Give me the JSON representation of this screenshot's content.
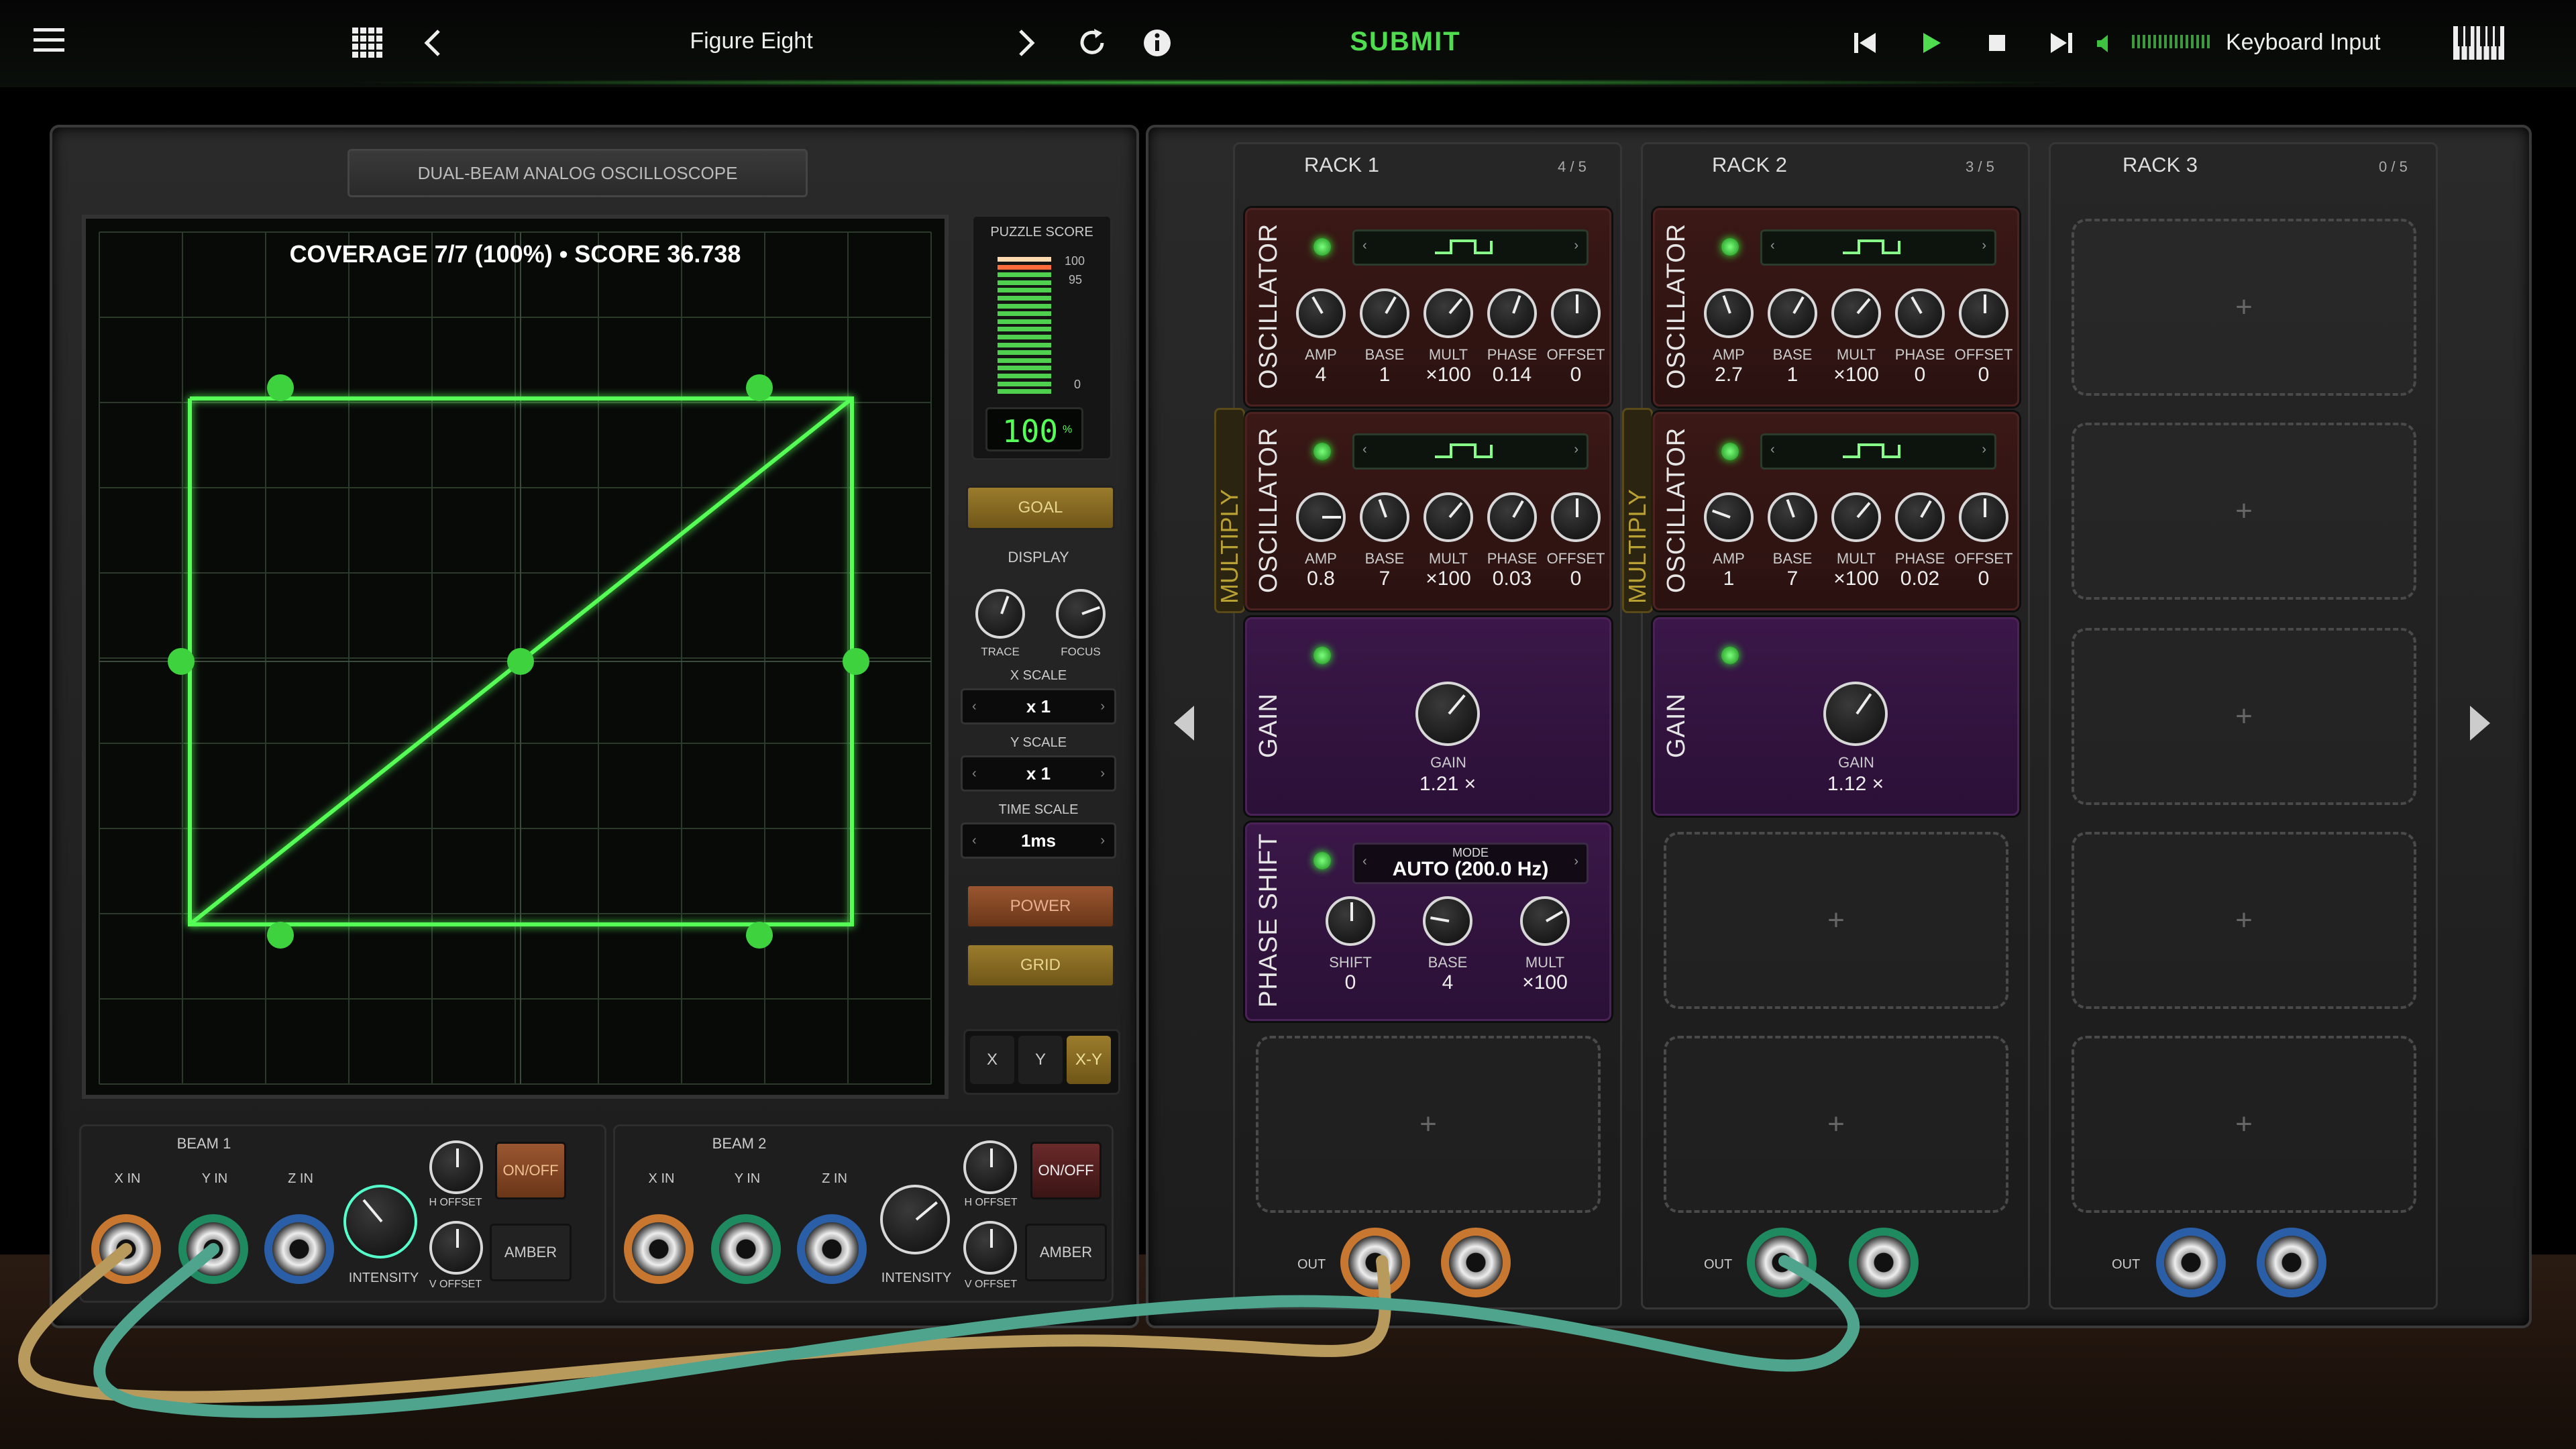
{
  "topbar": {
    "title": "Figure Eight",
    "submit": "SUBMIT",
    "keyboard_input": "Keyboard Input",
    "icons": [
      "menu-icon",
      "grid-icon",
      "chevron-left-icon",
      "chevron-right-icon",
      "restart-icon",
      "info-icon",
      "skip-back-icon",
      "play-icon",
      "stop-icon",
      "skip-forward-icon",
      "volume-icon",
      "piano-keys-icon"
    ]
  },
  "scope": {
    "nameplate": "DUAL-BEAM ANALOG OSCILLOSCOPE",
    "overlay": "COVERAGE 7/7 (100%)  •  SCORE 36.738",
    "trace_color": "#55ff55",
    "goal_points": 7,
    "puzzle_score_label": "PUZZLE SCORE",
    "meter_ticks": [
      "100",
      "95",
      "0"
    ],
    "score_readout": "100",
    "score_unit": "%",
    "meter_level": 1.0,
    "goal": "GOAL",
    "display": "DISPLAY",
    "trace": "TRACE",
    "focus": "FOCUS",
    "x_scale_label": "X SCALE",
    "x_scale": "x 1",
    "y_scale_label": "Y SCALE",
    "y_scale": "x 1",
    "time_scale_label": "TIME SCALE",
    "time_scale": "1ms",
    "power": "POWER",
    "grid": "GRID",
    "modes": [
      "X",
      "Y",
      "X-Y"
    ]
  },
  "beams": [
    {
      "title": "BEAM 1",
      "x_in": "X IN",
      "y_in": "Y IN",
      "z_in": "Z IN",
      "intensity": "INTENSITY",
      "h_offset": "H OFFSET",
      "v_offset": "V OFFSET",
      "onoff": "ON/OFF",
      "amber": "AMBER"
    },
    {
      "title": "BEAM 2",
      "x_in": "X IN",
      "y_in": "Y IN",
      "z_in": "Z IN",
      "intensity": "INTENSITY",
      "h_offset": "H OFFSET",
      "v_offset": "V OFFSET",
      "onoff": "ON/OFF",
      "amber": "AMBER"
    }
  ],
  "racks": [
    {
      "title": "RACK 1",
      "count": "4 / 5",
      "osc1": {
        "label": "OSCILLATOR",
        "knobs": [
          {
            "name": "AMP",
            "value": "4"
          },
          {
            "name": "BASE",
            "value": "1"
          },
          {
            "name": "MULT",
            "value": "×100"
          },
          {
            "name": "PHASE",
            "value": "0.14"
          },
          {
            "name": "OFFSET",
            "value": "0"
          }
        ]
      },
      "multiply": "MULTIPLY",
      "osc2": {
        "label": "OSCILLATOR",
        "knobs": [
          {
            "name": "AMP",
            "value": "0.8"
          },
          {
            "name": "BASE",
            "value": "7"
          },
          {
            "name": "MULT",
            "value": "×100"
          },
          {
            "name": "PHASE",
            "value": "0.03"
          },
          {
            "name": "OFFSET",
            "value": "0"
          }
        ]
      },
      "gain": {
        "label": "GAIN",
        "knob": "GAIN",
        "value": "1.21 ×"
      },
      "phase": {
        "label": "PHASE SHIFT",
        "mode_label": "MODE",
        "mode": "AUTO (200.0 Hz)",
        "knobs": [
          {
            "name": "SHIFT",
            "value": "0"
          },
          {
            "name": "BASE",
            "value": "4"
          },
          {
            "name": "MULT",
            "value": "×100"
          }
        ]
      },
      "out": "OUT",
      "plus": "+"
    },
    {
      "title": "RACK 2",
      "count": "3 / 5",
      "osc1": {
        "label": "OSCILLATOR",
        "knobs": [
          {
            "name": "AMP",
            "value": "2.7"
          },
          {
            "name": "BASE",
            "value": "1"
          },
          {
            "name": "MULT",
            "value": "×100"
          },
          {
            "name": "PHASE",
            "value": "0"
          },
          {
            "name": "OFFSET",
            "value": "0"
          }
        ]
      },
      "multiply": "MULTIPLY",
      "osc2": {
        "label": "OSCILLATOR",
        "knobs": [
          {
            "name": "AMP",
            "value": "1"
          },
          {
            "name": "BASE",
            "value": "7"
          },
          {
            "name": "MULT",
            "value": "×100"
          },
          {
            "name": "PHASE",
            "value": "0.02"
          },
          {
            "name": "OFFSET",
            "value": "0"
          }
        ]
      },
      "gain": {
        "label": "GAIN",
        "knob": "GAIN",
        "value": "1.12 ×"
      },
      "out": "OUT",
      "plus": "+"
    },
    {
      "title": "RACK 3",
      "count": "0 / 5",
      "out": "OUT",
      "plus": "+"
    }
  ]
}
